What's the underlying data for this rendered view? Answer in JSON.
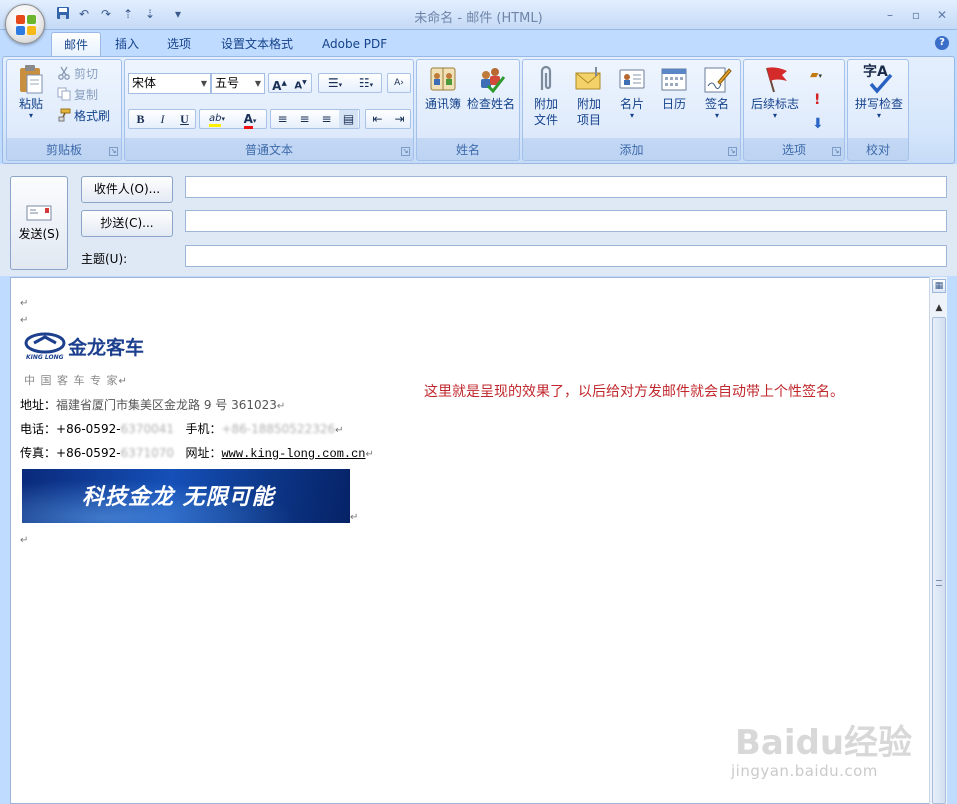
{
  "window": {
    "title": "未命名 - 邮件 (HTML)",
    "controls": [
      "–",
      "▫",
      "✕"
    ]
  },
  "qat": {
    "dropdown": "▾"
  },
  "tabs": [
    {
      "label": "邮件",
      "active": true
    },
    {
      "label": "插入",
      "active": false
    },
    {
      "label": "选项",
      "active": false
    },
    {
      "label": "设置文本格式",
      "active": false
    },
    {
      "label": "Adobe PDF",
      "active": false
    }
  ],
  "ribbon": {
    "clipboard": {
      "label": "剪贴板",
      "paste": "粘贴",
      "cut": "剪切",
      "copy": "复制",
      "format_painter": "格式刷"
    },
    "basic_text": {
      "label": "普通文本",
      "font_name": "宋体",
      "font_size": "五号",
      "grow": "A",
      "shrink": "A",
      "bold": "B",
      "italic": "I",
      "underline": "U",
      "highlight": "ab",
      "font_color": "A"
    },
    "names": {
      "label": "姓名",
      "address_book": "通讯簿",
      "check_names": "检查姓名"
    },
    "include": {
      "label": "添加",
      "attach_file": [
        "附加",
        "文件"
      ],
      "attach_item": [
        "附加",
        "项目"
      ],
      "business_card": "名片",
      "calendar": "日历",
      "signature": "签名"
    },
    "options": {
      "label": "选项",
      "follow_up": "后续标志"
    },
    "proofing": {
      "label": "校对",
      "spelling": "拼写检查",
      "icon_text": "字A"
    }
  },
  "header": {
    "send": "发送(S)",
    "to": "收件人(O)...",
    "cc": "抄送(C)...",
    "subject_label": "主题(U):",
    "to_value": "",
    "cc_value": "",
    "subject_value": ""
  },
  "body": {
    "pilcrow": "↵",
    "logo_text": "金龙客车",
    "logo_sub": "KING LONG",
    "slogan": "中 国 客 车 专 家",
    "address_label": "地址：",
    "address_value": "福建省厦门市集美区金龙路 9 号   361023",
    "phone_label": "电话：",
    "phone_value": "+86-0592-",
    "phone_blur": "6370041",
    "mobile_label": "手机：",
    "mobile_value": "+86-18850522326",
    "fax_label": "传真：",
    "fax_value": "+86-0592-",
    "fax_blur": "6371070",
    "web_label": "网址：",
    "web_value": "www.king-long.com.cn",
    "banner": "科技金龙  无限可能",
    "note": "这里就是呈现的效果了，以后给对方发邮件就会自动带上个性签名。"
  },
  "watermark": {
    "brand": "Baidu经验",
    "url": "jingyan.baidu.com"
  }
}
